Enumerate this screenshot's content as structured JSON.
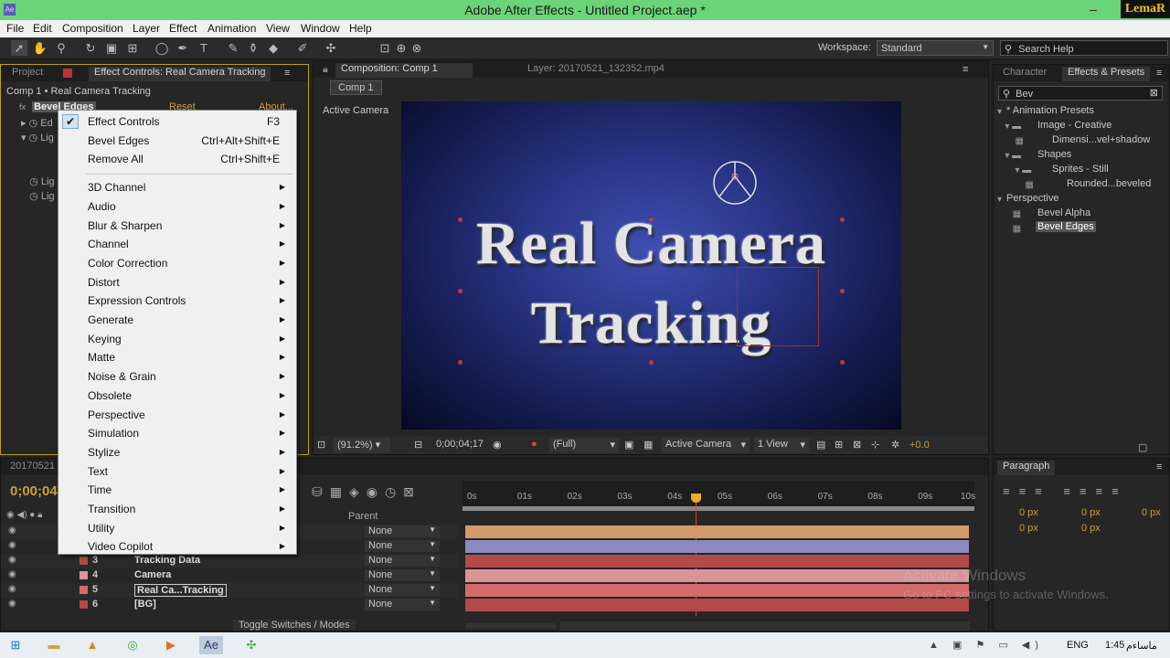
{
  "window": {
    "title": "Adobe After Effects - Untitled Project.aep *",
    "corner_logo": "LemaR"
  },
  "menu": [
    "File",
    "Edit",
    "Composition",
    "Layer",
    "Effect",
    "Animation",
    "View",
    "Window",
    "Help"
  ],
  "workspace": {
    "label": "Workspace:",
    "value": "Standard"
  },
  "search_help": "Search Help",
  "left_panel": {
    "tab_project": "Project",
    "tab_effect_controls": "Effect Controls: Real Camera Tracking",
    "breadcrumb": "Comp 1 • Real Camera Tracking",
    "effect_name": "Bevel Edges",
    "reset": "Reset",
    "about": "About..."
  },
  "context_menu": {
    "top_items": [
      {
        "label": "Effect Controls",
        "shortcut": "F3",
        "checked": true
      },
      {
        "label": "Bevel Edges",
        "shortcut": "Ctrl+Alt+Shift+E"
      },
      {
        "label": "Remove All",
        "shortcut": "Ctrl+Shift+E"
      }
    ],
    "submenus": [
      "3D Channel",
      "Audio",
      "Blur & Sharpen",
      "Channel",
      "Color Correction",
      "Distort",
      "Expression Controls",
      "Generate",
      "Keying",
      "Matte",
      "Noise & Grain",
      "Obsolete",
      "Perspective",
      "Simulation",
      "Stylize",
      "Text",
      "Time",
      "Transition",
      "Utility",
      "Video Copilot"
    ]
  },
  "composition": {
    "tab": "Composition: Comp 1",
    "layer_tab": "Layer: 20170521_132352.mp4",
    "comp_button": "Comp 1",
    "view_label": "Active Camera",
    "line1": "Real Camera",
    "line2": "Tracking"
  },
  "viewer_bar": {
    "zoom": "(91.2%)",
    "timecode": "0;00;04;17",
    "resolution": "(Full)",
    "camera": "Active Camera",
    "views": "1 View",
    "exposure": "+0.0"
  },
  "right_panel": {
    "tab_character": "Character",
    "tab_effects": "Effects & Presets",
    "search": "Bev",
    "tree": [
      {
        "label": "* Animation Presets",
        "level": 0
      },
      {
        "label": "Image - Creative",
        "level": 1
      },
      {
        "label": "Dimensi...vel+shadow",
        "level": 2
      },
      {
        "label": "Shapes",
        "level": 1
      },
      {
        "label": "Sprites - Still",
        "level": 2
      },
      {
        "label": "Rounded...beveled",
        "level": 3
      },
      {
        "label": "Perspective",
        "level": 0
      },
      {
        "label": "Bevel Alpha",
        "level": 1
      },
      {
        "label": "Bevel Edges",
        "level": 1,
        "selected": true
      }
    ]
  },
  "paragraph": {
    "tab": "Paragraph",
    "fields": [
      "0 px",
      "0 px",
      "0 px",
      "0 px",
      "0 px"
    ]
  },
  "timeline": {
    "timecode": "0;00;04",
    "comp_tab": "20170521",
    "parent_header": "Parent",
    "ruler": [
      "0s",
      "01s",
      "02s",
      "03s",
      "04s",
      "05s",
      "06s",
      "07s",
      "08s",
      "09s",
      "10s"
    ],
    "playhead_seconds": 4.57,
    "layers": [
      {
        "num": "",
        "name": "",
        "parent": "None",
        "color": "#d39a6a"
      },
      {
        "num": "",
        "name": "",
        "parent": "None",
        "color": "#8a8ac0"
      },
      {
        "num": "3",
        "name": "Tracking Data",
        "parent": "None",
        "color": "#b34a4a"
      },
      {
        "num": "4",
        "name": "Camera",
        "parent": "None",
        "color": "#d9949a"
      },
      {
        "num": "5",
        "name": "Real Ca...Tracking",
        "parent": "None",
        "color": "#d46a6a"
      },
      {
        "num": "6",
        "name": "[BG]",
        "parent": "None",
        "color": "#b34a4a"
      }
    ],
    "toggle": "Toggle Switches / Modes"
  },
  "watermark": {
    "line1": "Activate Windows",
    "line2": "Go to PC settings to activate Windows."
  },
  "taskbar": {
    "lang": "ENG",
    "time": "1:45",
    "ampm": "ماساءم"
  }
}
